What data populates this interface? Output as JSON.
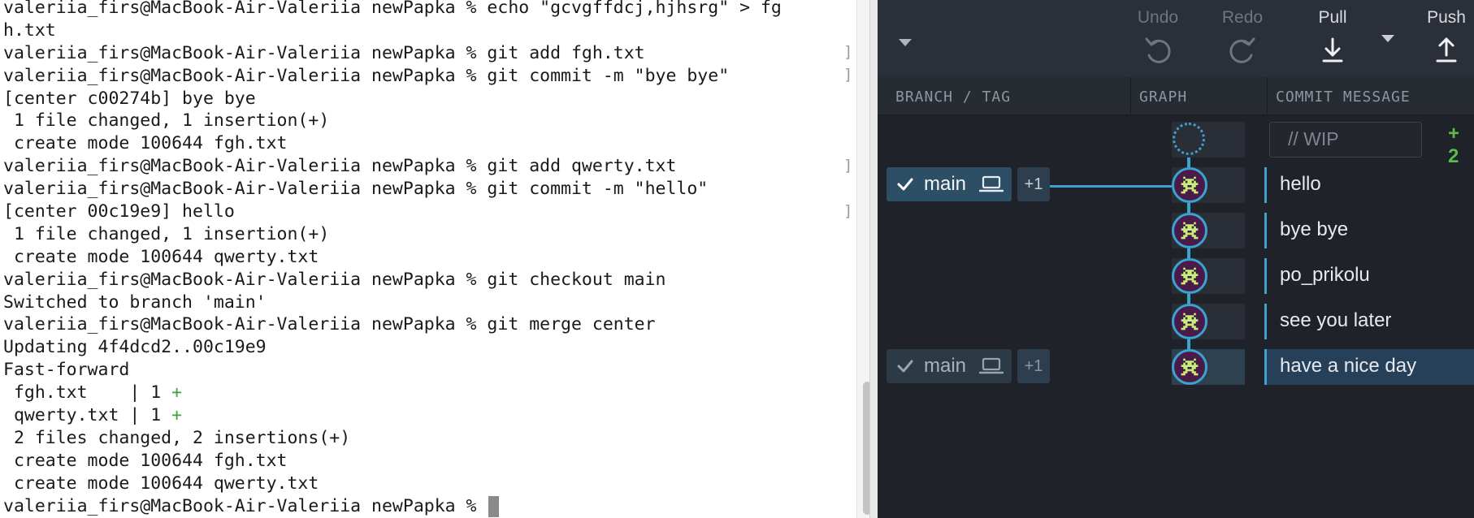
{
  "terminal": {
    "lines": [
      {
        "text": "valeriia_firs@MacBook-Air-Valeriia newPapka % echo \"gcvgffdcj,hjhsrg\" > fg"
      },
      {
        "text": "h.txt"
      },
      {
        "text": "valeriia_firs@MacBook-Air-Valeriia newPapka % git add fgh.txt"
      },
      {
        "text": "valeriia_firs@MacBook-Air-Valeriia newPapka % git commit -m \"bye bye\""
      },
      {
        "text": "[center c00274b] bye bye"
      },
      {
        "text": " 1 file changed, 1 insertion(+)"
      },
      {
        "text": " create mode 100644 fgh.txt"
      },
      {
        "text": "valeriia_firs@MacBook-Air-Valeriia newPapka % git add qwerty.txt"
      },
      {
        "text": "valeriia_firs@MacBook-Air-Valeriia newPapka % git commit -m \"hello\""
      },
      {
        "text": "[center 00c19e9] hello"
      },
      {
        "text": " 1 file changed, 1 insertion(+)"
      },
      {
        "text": " create mode 100644 qwerty.txt"
      },
      {
        "text": "valeriia_firs@MacBook-Air-Valeriia newPapka % git checkout main"
      },
      {
        "text": "Switched to branch 'main'"
      },
      {
        "text": "valeriia_firs@MacBook-Air-Valeriia newPapka % git merge center"
      },
      {
        "text": "Updating 4f4dcd2..00c19e9"
      },
      {
        "text": "Fast-forward"
      },
      {
        "text": " fgh.txt    | 1 ",
        "suffix": "+"
      },
      {
        "text": " qwerty.txt | 1 ",
        "suffix": "+"
      },
      {
        "text": " 2 files changed, 2 insertions(+)"
      },
      {
        "text": " create mode 100644 fgh.txt"
      },
      {
        "text": " create mode 100644 qwerty.txt"
      },
      {
        "text": "valeriia_firs@MacBook-Air-Valeriia newPapka % ",
        "cursor": true
      }
    ],
    "right_marker": "]"
  },
  "toolbar": {
    "undo_label": "Undo",
    "redo_label": "Redo",
    "pull_label": "Pull",
    "push_label": "Push"
  },
  "columns": {
    "branch_tag": "BRANCH / TAG",
    "graph": "GRAPH",
    "commit_message": "COMMIT MESSAGE"
  },
  "wip": {
    "placeholder": "// WIP",
    "plus": "+ 2"
  },
  "branches": {
    "main_label": "main",
    "ahead_badge": "+1"
  },
  "commits": [
    {
      "message": "hello"
    },
    {
      "message": "bye bye"
    },
    {
      "message": "po_prikolu"
    },
    {
      "message": "see you later"
    },
    {
      "message": "have a nice day"
    }
  ],
  "colors": {
    "accent": "#3ca2cf",
    "avatar_bg": "#4a1a48",
    "avatar_fg": "#c4f07a",
    "app_bg": "#1f2228"
  }
}
